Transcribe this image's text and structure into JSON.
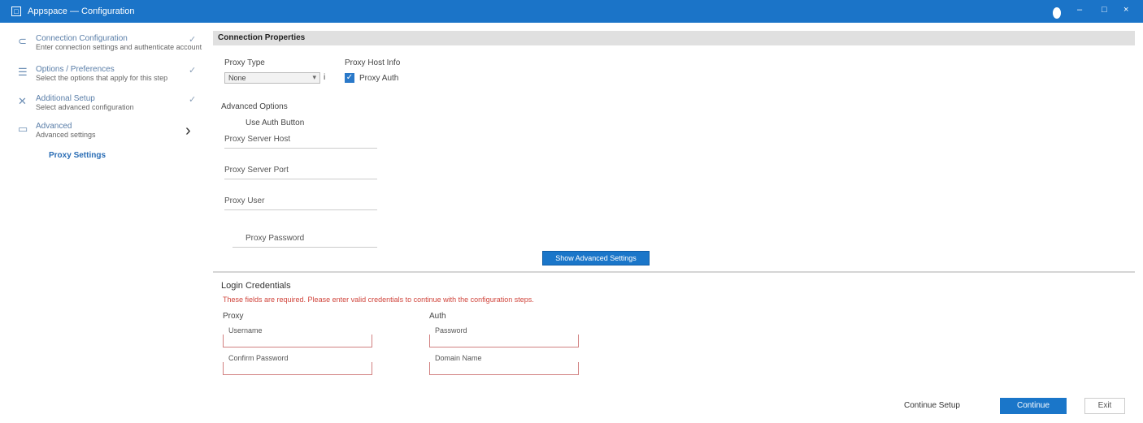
{
  "window": {
    "title": "Appspace — Configuration",
    "controls": [
      "●",
      "–",
      "□",
      "×"
    ]
  },
  "sidebar": {
    "steps": [
      {
        "icon": "link-icon",
        "title": "Connection Configuration",
        "subtitle": "Enter connection settings and authenticate account",
        "status": "✓"
      },
      {
        "icon": "list-icon",
        "title": "Options / Preferences",
        "subtitle": "Select the options that apply for this step",
        "status": "✓"
      },
      {
        "icon": "cross-icon",
        "title": "Additional Setup",
        "subtitle": "Select advanced configuration",
        "status": "✓"
      },
      {
        "icon": "window-icon",
        "title": "Advanced",
        "subtitle": "Advanced settings",
        "status": "›"
      }
    ],
    "active_sub": "Proxy Settings"
  },
  "main": {
    "section_title": "Connection Properties",
    "proxy_type_label": "Proxy Type",
    "proxy_type_value": "None",
    "proxy_host_label": "Proxy Host Info",
    "use_auth_label": "Proxy Auth",
    "use_auth_checked": true,
    "advanced_label": "Advanced Options",
    "auth_button_label": "Use Auth Button",
    "field_labels": [
      "Proxy Server Host",
      "Proxy Server Port",
      "Proxy User"
    ],
    "password_label": "Proxy Password",
    "toggle_button": "Show Advanced Settings",
    "login_section": "Login Credentials",
    "warning": "These fields are required. Please enter valid credentials to continue with the configuration steps.",
    "left_col_label": "Proxy",
    "right_col_label": "Auth",
    "inputs": [
      {
        "label": "Username",
        "value": ""
      },
      {
        "label": "Password",
        "value": ""
      },
      {
        "label": "Confirm Password",
        "value": ""
      },
      {
        "label": "Domain Name",
        "value": ""
      }
    ]
  },
  "footer": {
    "advanced_link": "Continue Setup",
    "next_button": "Continue",
    "cancel_button": "Exit"
  }
}
